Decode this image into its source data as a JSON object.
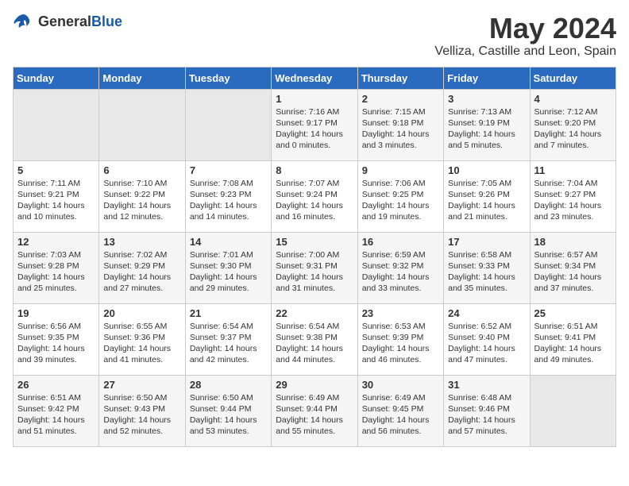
{
  "logo": {
    "general": "General",
    "blue": "Blue"
  },
  "header": {
    "month": "May 2024",
    "location": "Velliza, Castille and Leon, Spain"
  },
  "days_of_week": [
    "Sunday",
    "Monday",
    "Tuesday",
    "Wednesday",
    "Thursday",
    "Friday",
    "Saturday"
  ],
  "weeks": [
    [
      {
        "day": "",
        "empty": true
      },
      {
        "day": "",
        "empty": true
      },
      {
        "day": "",
        "empty": true
      },
      {
        "day": "1",
        "sunrise": "Sunrise: 7:16 AM",
        "sunset": "Sunset: 9:17 PM",
        "daylight": "Daylight: 14 hours and 0 minutes."
      },
      {
        "day": "2",
        "sunrise": "Sunrise: 7:15 AM",
        "sunset": "Sunset: 9:18 PM",
        "daylight": "Daylight: 14 hours and 3 minutes."
      },
      {
        "day": "3",
        "sunrise": "Sunrise: 7:13 AM",
        "sunset": "Sunset: 9:19 PM",
        "daylight": "Daylight: 14 hours and 5 minutes."
      },
      {
        "day": "4",
        "sunrise": "Sunrise: 7:12 AM",
        "sunset": "Sunset: 9:20 PM",
        "daylight": "Daylight: 14 hours and 7 minutes."
      }
    ],
    [
      {
        "day": "5",
        "sunrise": "Sunrise: 7:11 AM",
        "sunset": "Sunset: 9:21 PM",
        "daylight": "Daylight: 14 hours and 10 minutes."
      },
      {
        "day": "6",
        "sunrise": "Sunrise: 7:10 AM",
        "sunset": "Sunset: 9:22 PM",
        "daylight": "Daylight: 14 hours and 12 minutes."
      },
      {
        "day": "7",
        "sunrise": "Sunrise: 7:08 AM",
        "sunset": "Sunset: 9:23 PM",
        "daylight": "Daylight: 14 hours and 14 minutes."
      },
      {
        "day": "8",
        "sunrise": "Sunrise: 7:07 AM",
        "sunset": "Sunset: 9:24 PM",
        "daylight": "Daylight: 14 hours and 16 minutes."
      },
      {
        "day": "9",
        "sunrise": "Sunrise: 7:06 AM",
        "sunset": "Sunset: 9:25 PM",
        "daylight": "Daylight: 14 hours and 19 minutes."
      },
      {
        "day": "10",
        "sunrise": "Sunrise: 7:05 AM",
        "sunset": "Sunset: 9:26 PM",
        "daylight": "Daylight: 14 hours and 21 minutes."
      },
      {
        "day": "11",
        "sunrise": "Sunrise: 7:04 AM",
        "sunset": "Sunset: 9:27 PM",
        "daylight": "Daylight: 14 hours and 23 minutes."
      }
    ],
    [
      {
        "day": "12",
        "sunrise": "Sunrise: 7:03 AM",
        "sunset": "Sunset: 9:28 PM",
        "daylight": "Daylight: 14 hours and 25 minutes."
      },
      {
        "day": "13",
        "sunrise": "Sunrise: 7:02 AM",
        "sunset": "Sunset: 9:29 PM",
        "daylight": "Daylight: 14 hours and 27 minutes."
      },
      {
        "day": "14",
        "sunrise": "Sunrise: 7:01 AM",
        "sunset": "Sunset: 9:30 PM",
        "daylight": "Daylight: 14 hours and 29 minutes."
      },
      {
        "day": "15",
        "sunrise": "Sunrise: 7:00 AM",
        "sunset": "Sunset: 9:31 PM",
        "daylight": "Daylight: 14 hours and 31 minutes."
      },
      {
        "day": "16",
        "sunrise": "Sunrise: 6:59 AM",
        "sunset": "Sunset: 9:32 PM",
        "daylight": "Daylight: 14 hours and 33 minutes."
      },
      {
        "day": "17",
        "sunrise": "Sunrise: 6:58 AM",
        "sunset": "Sunset: 9:33 PM",
        "daylight": "Daylight: 14 hours and 35 minutes."
      },
      {
        "day": "18",
        "sunrise": "Sunrise: 6:57 AM",
        "sunset": "Sunset: 9:34 PM",
        "daylight": "Daylight: 14 hours and 37 minutes."
      }
    ],
    [
      {
        "day": "19",
        "sunrise": "Sunrise: 6:56 AM",
        "sunset": "Sunset: 9:35 PM",
        "daylight": "Daylight: 14 hours and 39 minutes."
      },
      {
        "day": "20",
        "sunrise": "Sunrise: 6:55 AM",
        "sunset": "Sunset: 9:36 PM",
        "daylight": "Daylight: 14 hours and 41 minutes."
      },
      {
        "day": "21",
        "sunrise": "Sunrise: 6:54 AM",
        "sunset": "Sunset: 9:37 PM",
        "daylight": "Daylight: 14 hours and 42 minutes."
      },
      {
        "day": "22",
        "sunrise": "Sunrise: 6:54 AM",
        "sunset": "Sunset: 9:38 PM",
        "daylight": "Daylight: 14 hours and 44 minutes."
      },
      {
        "day": "23",
        "sunrise": "Sunrise: 6:53 AM",
        "sunset": "Sunset: 9:39 PM",
        "daylight": "Daylight: 14 hours and 46 minutes."
      },
      {
        "day": "24",
        "sunrise": "Sunrise: 6:52 AM",
        "sunset": "Sunset: 9:40 PM",
        "daylight": "Daylight: 14 hours and 47 minutes."
      },
      {
        "day": "25",
        "sunrise": "Sunrise: 6:51 AM",
        "sunset": "Sunset: 9:41 PM",
        "daylight": "Daylight: 14 hours and 49 minutes."
      }
    ],
    [
      {
        "day": "26",
        "sunrise": "Sunrise: 6:51 AM",
        "sunset": "Sunset: 9:42 PM",
        "daylight": "Daylight: 14 hours and 51 minutes."
      },
      {
        "day": "27",
        "sunrise": "Sunrise: 6:50 AM",
        "sunset": "Sunset: 9:43 PM",
        "daylight": "Daylight: 14 hours and 52 minutes."
      },
      {
        "day": "28",
        "sunrise": "Sunrise: 6:50 AM",
        "sunset": "Sunset: 9:44 PM",
        "daylight": "Daylight: 14 hours and 53 minutes."
      },
      {
        "day": "29",
        "sunrise": "Sunrise: 6:49 AM",
        "sunset": "Sunset: 9:44 PM",
        "daylight": "Daylight: 14 hours and 55 minutes."
      },
      {
        "day": "30",
        "sunrise": "Sunrise: 6:49 AM",
        "sunset": "Sunset: 9:45 PM",
        "daylight": "Daylight: 14 hours and 56 minutes."
      },
      {
        "day": "31",
        "sunrise": "Sunrise: 6:48 AM",
        "sunset": "Sunset: 9:46 PM",
        "daylight": "Daylight: 14 hours and 57 minutes."
      },
      {
        "day": "",
        "empty": true
      }
    ]
  ]
}
